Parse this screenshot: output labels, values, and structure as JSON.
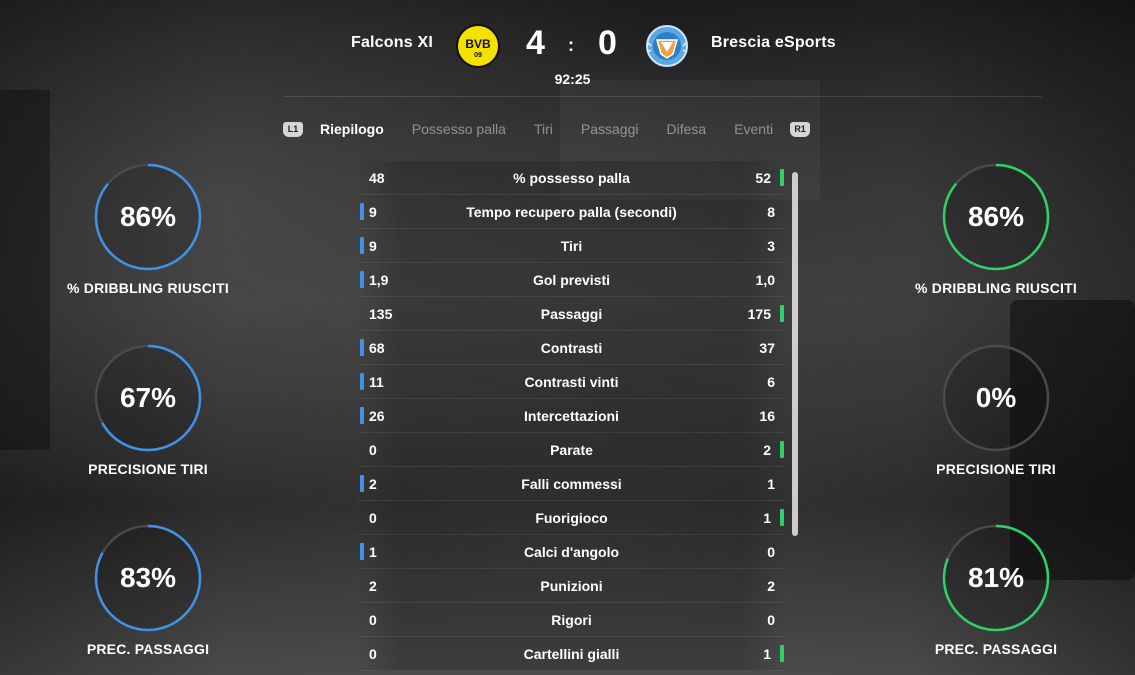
{
  "match": {
    "home_team": "Falcons XI",
    "away_team": "Brescia eSports",
    "home_score": "4",
    "away_score": "0",
    "score_separator": ":",
    "clock": "92:25",
    "home_crest_text": "BVB",
    "home_crest_subtext": "09"
  },
  "tabs": {
    "left_hint": "L1",
    "right_hint": "R1",
    "items": [
      "Riepilogo",
      "Possesso palla",
      "Tiri",
      "Passaggi",
      "Difesa",
      "Eventi"
    ],
    "active": "Riepilogo"
  },
  "rings": {
    "home": [
      {
        "value": "86%",
        "fraction": 0.86,
        "label": "% DRIBBLING RIUSCITI"
      },
      {
        "value": "67%",
        "fraction": 0.67,
        "label": "PRECISIONE TIRI"
      },
      {
        "value": "83%",
        "fraction": 0.83,
        "label": "PREC. PASSAGGI"
      }
    ],
    "away": [
      {
        "value": "86%",
        "fraction": 0.86,
        "label": "% DRIBBLING RIUSCITI"
      },
      {
        "value": "0%",
        "fraction": 0.0,
        "label": "PRECISIONE TIRI"
      },
      {
        "value": "81%",
        "fraction": 0.81,
        "label": "PREC. PASSAGGI"
      }
    ]
  },
  "stats": [
    {
      "label": "% possesso palla",
      "home": "48",
      "away": "52",
      "leader": "away"
    },
    {
      "label": "Tempo recupero palla (secondi)",
      "home": "9",
      "away": "8",
      "leader": "home"
    },
    {
      "label": "Tiri",
      "home": "9",
      "away": "3",
      "leader": "home"
    },
    {
      "label": "Gol previsti",
      "home": "1,9",
      "away": "1,0",
      "leader": "home"
    },
    {
      "label": "Passaggi",
      "home": "135",
      "away": "175",
      "leader": "away"
    },
    {
      "label": "Contrasti",
      "home": "68",
      "away": "37",
      "leader": "home"
    },
    {
      "label": "Contrasti vinti",
      "home": "11",
      "away": "6",
      "leader": "home"
    },
    {
      "label": "Intercettazioni",
      "home": "26",
      "away": "16",
      "leader": "home"
    },
    {
      "label": "Parate",
      "home": "0",
      "away": "2",
      "leader": "away"
    },
    {
      "label": "Falli commessi",
      "home": "2",
      "away": "1",
      "leader": "home"
    },
    {
      "label": "Fuorigioco",
      "home": "0",
      "away": "1",
      "leader": "away"
    },
    {
      "label": "Calci d'angolo",
      "home": "1",
      "away": "0",
      "leader": "home"
    },
    {
      "label": "Punizioni",
      "home": "2",
      "away": "2",
      "leader": "none"
    },
    {
      "label": "Rigori",
      "home": "0",
      "away": "0",
      "leader": "none"
    },
    {
      "label": "Cartellini gialli",
      "home": "0",
      "away": "1",
      "leader": "away"
    }
  ],
  "colors": {
    "home_accent": "#3f92e6",
    "away_accent": "#2fd06a",
    "ring_track": "#4a4a4a"
  }
}
